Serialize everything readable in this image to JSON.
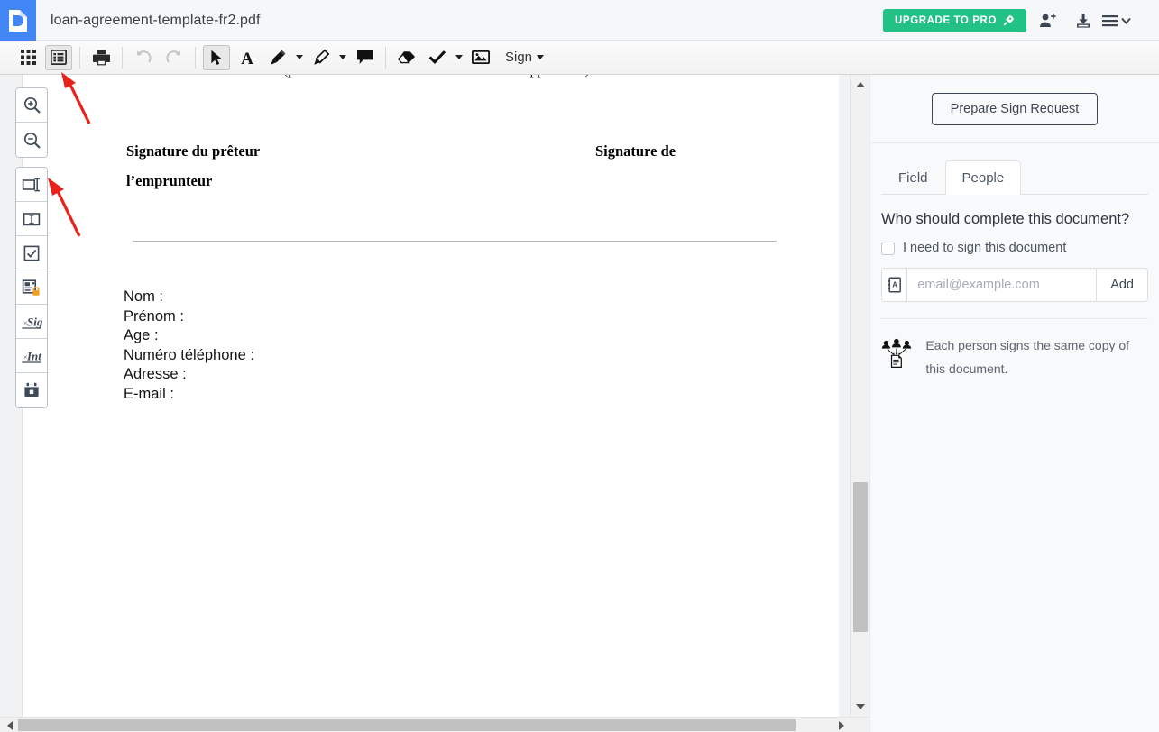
{
  "app": {
    "logo_icon": "document-logo-icon",
    "document_title": "loan-agreement-template-fr2.pdf"
  },
  "header": {
    "upgrade_label": "UPGRADE TO PRO",
    "upgrade_icon": "rocket-icon",
    "upgrade_color": "#22c286",
    "add_user_icon": "add-user-icon",
    "download_icon": "download-icon",
    "menu_icon": "hamburger-menu-icon",
    "menu_caret_icon": "chevron-down-icon"
  },
  "toolbar": {
    "items": [
      {
        "name": "grid-view-button",
        "icon": "grid-icon",
        "active": false
      },
      {
        "name": "list-view-button",
        "icon": "list-panel-icon",
        "active": true
      },
      {
        "name": "print-button",
        "icon": "printer-icon",
        "active": false
      },
      {
        "name": "undo-button",
        "icon": "undo-arrow-icon",
        "active": false,
        "disabled": true
      },
      {
        "name": "redo-button",
        "icon": "redo-arrow-icon",
        "active": false,
        "disabled": true
      },
      {
        "name": "select-tool-button",
        "icon": "cursor-arrow-icon",
        "active": true
      },
      {
        "name": "text-tool-button",
        "icon": "text-a-icon",
        "active": false
      },
      {
        "name": "pen-tool-button",
        "icon": "pen-icon",
        "active": false
      },
      {
        "name": "highlighter-tool-button",
        "icon": "highlighter-icon",
        "active": false
      },
      {
        "name": "comment-tool-button",
        "icon": "speech-bubble-icon",
        "active": false
      },
      {
        "name": "eraser-tool-button",
        "icon": "eraser-icon",
        "active": false
      },
      {
        "name": "check-tool-button",
        "icon": "checkmark-icon",
        "active": false
      },
      {
        "name": "image-tool-button",
        "icon": "image-icon",
        "active": false
      }
    ],
    "sign_label": "Sign",
    "sign_caret_icon": "chevron-down-icon"
  },
  "left_rail": {
    "zoom_group": [
      {
        "name": "zoom-in-button",
        "icon": "magnifier-plus-icon"
      },
      {
        "name": "zoom-out-button",
        "icon": "magnifier-minus-icon"
      }
    ],
    "field_group": [
      {
        "name": "text-field-tool",
        "icon": "text-field-icon"
      },
      {
        "name": "text-box-tool",
        "icon": "text-box-icon"
      },
      {
        "name": "checkbox-field-tool",
        "icon": "checkbox-field-icon"
      },
      {
        "name": "locked-field-tool",
        "icon": "locked-form-icon"
      },
      {
        "name": "signature-field-tool",
        "icon": "signature-sig-icon"
      },
      {
        "name": "initials-field-tool",
        "icon": "initials-int-icon"
      },
      {
        "name": "date-field-tool",
        "icon": "calendar-date-icon"
      }
    ]
  },
  "document": {
    "clipped_line": "(précédée de la mention manuscrite \"Lu et approuvé.\")",
    "signature_lender": "Signature du prêteur",
    "signature_lender_line2": "l’emprunteur",
    "signature_borrower": "Signature de",
    "fields": [
      "Nom :",
      "Prénom :",
      "Age :",
      "Numéro téléphone :",
      "Adresse :",
      "E-mail :"
    ]
  },
  "right_panel": {
    "prepare_button": "Prepare Sign Request",
    "tabs": [
      {
        "label": "Field",
        "name": "tab-field",
        "active": false
      },
      {
        "label": "People",
        "name": "tab-people",
        "active": true
      }
    ],
    "question": "Who should complete this document?",
    "self_sign_label": "I need to sign this document",
    "self_sign_checked": false,
    "contacts_icon": "address-book-icon",
    "email_placeholder": "email@example.com",
    "email_value": "",
    "add_label": "Add",
    "hint_icon": "people-sharing-document-icon",
    "hint_text": "Each person signs the same copy of this document."
  },
  "scrollbars": {
    "vertical_up_icon": "triangle-up-icon",
    "vertical_down_icon": "triangle-down-icon",
    "horizontal_left_icon": "triangle-left-icon",
    "horizontal_right_icon": "triangle-right-icon"
  },
  "annotations": {
    "arrow_color": "#e8221a",
    "arrows": [
      {
        "name": "annotation-arrow-list-view",
        "target": "list-view-button"
      },
      {
        "name": "annotation-arrow-text-field-tool",
        "target": "text-field-tool"
      }
    ]
  }
}
